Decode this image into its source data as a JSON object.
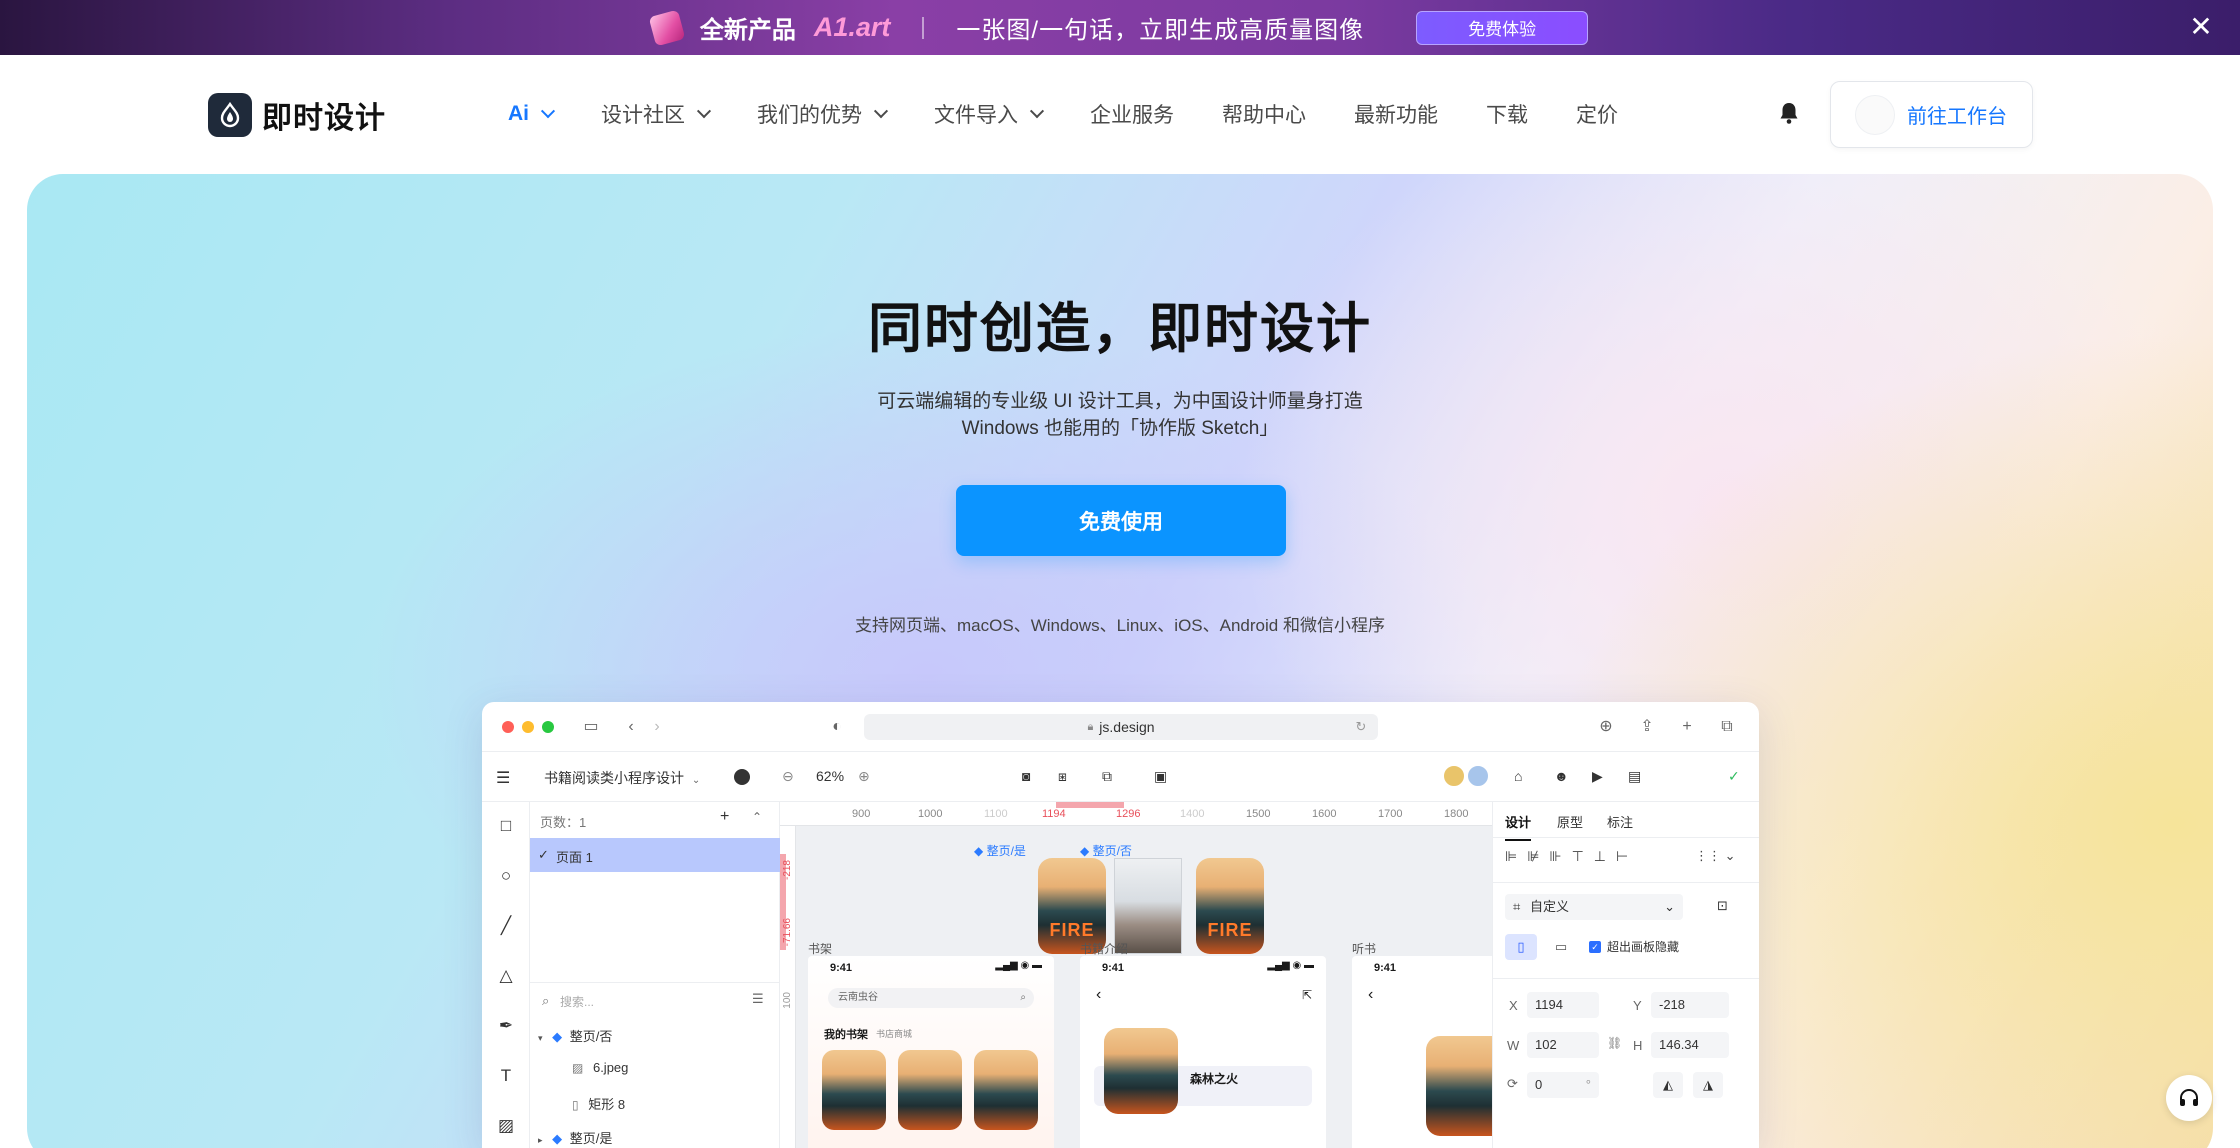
{
  "promo": {
    "new_label": "全新产品",
    "brand": "A1.art",
    "text": "一张图/一句话，立即生成高质量图像",
    "button": "免费体验"
  },
  "header": {
    "logo_text": "即时设计",
    "nav": [
      {
        "label": "Ai",
        "dropdown": true,
        "active": true
      },
      {
        "label": "设计社区",
        "dropdown": true
      },
      {
        "label": "我们的优势",
        "dropdown": true
      },
      {
        "label": "文件导入",
        "dropdown": true
      },
      {
        "label": "企业服务",
        "dropdown": false
      },
      {
        "label": "帮助中心",
        "dropdown": false
      },
      {
        "label": "最新功能",
        "dropdown": false
      },
      {
        "label": "下载",
        "dropdown": false
      },
      {
        "label": "定价",
        "dropdown": false
      }
    ],
    "workbench": "前往工作台"
  },
  "hero": {
    "title": "同时创造，即时设计",
    "subtitle_line1": "可云端编辑的专业级 UI 设计工具，为中国设计师量身打造",
    "subtitle_line2": "Windows 也能用的「协作版 Sketch」",
    "cta": "免费使用",
    "platforms": "支持网页端、macOS、Windows、Linux、iOS、Android 和微信小程序"
  },
  "app": {
    "url": "js.design",
    "file_name": "书籍阅读类小程序设计",
    "zoom": "62%",
    "pages_label": "页数：1",
    "page_item": "页面 1",
    "search_placeholder": "搜索...",
    "layers": [
      {
        "name": "整页/否",
        "type": "component",
        "level": 0,
        "expanded": true
      },
      {
        "name": "6.jpeg",
        "type": "image",
        "level": 1
      },
      {
        "name": "矩形 8",
        "type": "rect",
        "level": 1
      },
      {
        "name": "整页/是",
        "type": "component",
        "level": 0,
        "expanded": false
      }
    ],
    "ruler_ticks": [
      "900",
      "1000",
      "1100",
      "1194",
      "1296",
      "1400",
      "1500",
      "1600",
      "1700",
      "1800"
    ],
    "ruler_v_ticks": [
      "-218",
      "-71.66",
      "100"
    ],
    "canvas": {
      "comp_label_1": "整页/是",
      "comp_label_2": "整页/否",
      "book_text": "FIRE",
      "frame_labels": [
        "书架",
        "书籍介绍",
        "听书"
      ],
      "time": "9:41",
      "search_text": "云南虫谷",
      "shelf_tab_1": "我的书架",
      "shelf_tab_2": "书店商城",
      "book_title": "森林之火"
    },
    "props": {
      "tabs": [
        "设计",
        "原型",
        "标注"
      ],
      "preset": "自定义",
      "clip_label": "超出画板隐藏",
      "x_label": "X",
      "x": "1194",
      "y_label": "Y",
      "y": "-218",
      "w_label": "W",
      "w": "102",
      "h_label": "H",
      "h": "146.34",
      "rotation": "0",
      "degree": "°"
    }
  }
}
